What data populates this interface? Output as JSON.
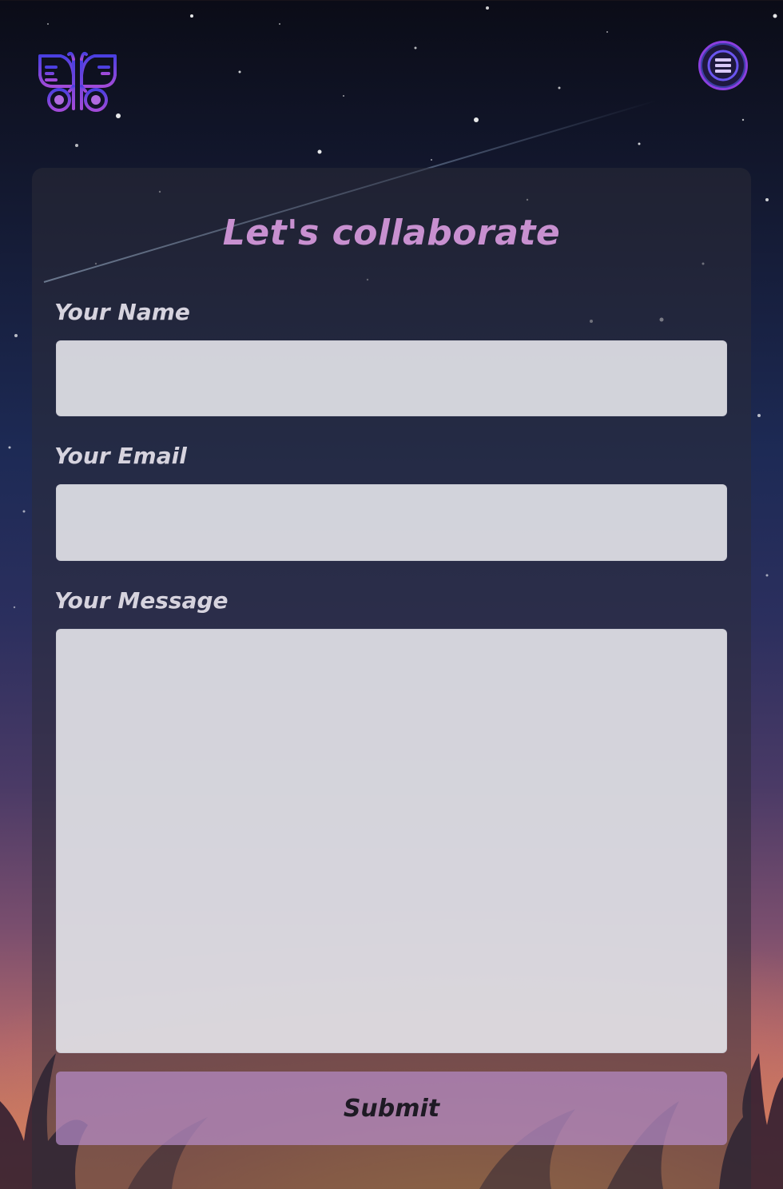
{
  "header": {
    "logo_icon": "butterfly-icon",
    "menu_icon": "hamburger-menu-icon"
  },
  "form": {
    "title": "Let's collaborate",
    "name_label": "Your Name",
    "name_value": "",
    "email_label": "Your Email",
    "email_value": "",
    "message_label": "Your Message",
    "message_value": "",
    "submit_label": "Submit"
  },
  "colors": {
    "accent": "#c890d0",
    "logo_blue": "#4a3fe0",
    "logo_purple": "#a24ad8",
    "submit_bg": "#b68cc8"
  }
}
